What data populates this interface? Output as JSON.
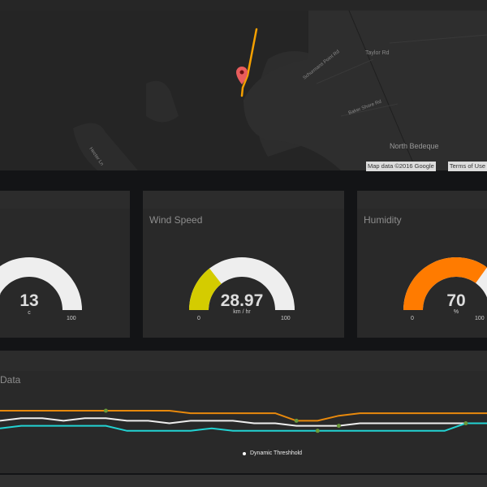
{
  "map": {
    "labels": [
      "Taylor Rd",
      "Schurmans Point Rd",
      "Baker Shore Rd",
      "North Bedeque",
      "Hector Ln"
    ],
    "attribution": "Map data ©2016 Google",
    "terms": "Terms of Use",
    "marker_icon": "map-pin-icon",
    "track_color": "#f5a000",
    "marker_color": "#e85c5c"
  },
  "gauges": [
    {
      "title": "",
      "value": "13",
      "unit": "c",
      "min": "",
      "max": "100",
      "fraction": 0.13,
      "color": "#eeeeee"
    },
    {
      "title": "Wind Speed",
      "value": "28.97",
      "unit": "km / hr",
      "min": "0",
      "max": "100",
      "fraction": 0.2897,
      "color": "#d4cc00"
    },
    {
      "title": "Humidity",
      "value": "70",
      "unit": "%",
      "min": "0",
      "max": "100",
      "fraction": 0.7,
      "color": "#ff7b00"
    }
  ],
  "chart": {
    "title": "Data",
    "legend": [
      "Dynamic Threshhold"
    ],
    "chart_data": {
      "type": "line",
      "series": [
        {
          "color": "#e8890c",
          "values": [
            10,
            10,
            10,
            10,
            10,
            10,
            10,
            10,
            10,
            9.5,
            9.5,
            9.5,
            9.5,
            9.5,
            8,
            8,
            9,
            9.5,
            9.5,
            9.5,
            9.5,
            9.5,
            9.5,
            9.5
          ]
        },
        {
          "color": "#eeeeee",
          "values": [
            8,
            8.5,
            8.5,
            8,
            8.5,
            8.5,
            8,
            8,
            7.5,
            8,
            8,
            8,
            7.5,
            7.5,
            7,
            7,
            7,
            7.5,
            7.5,
            7.5,
            7.5,
            7.5,
            7.5,
            7.5
          ]
        },
        {
          "color": "#22d3d3",
          "values": [
            6.5,
            7,
            7,
            7,
            7,
            7,
            6,
            6,
            6,
            6,
            6.5,
            6,
            6,
            6,
            6,
            6,
            6,
            6,
            6,
            6,
            6,
            6,
            7.5,
            7.5
          ]
        }
      ],
      "markers": [
        {
          "series": 0,
          "index": 5
        },
        {
          "series": 0,
          "index": 14
        },
        {
          "series": 1,
          "index": 16
        },
        {
          "series": 2,
          "index": 15
        },
        {
          "series": 1,
          "index": 22
        }
      ],
      "marker_color": "#6a9a3a"
    }
  }
}
